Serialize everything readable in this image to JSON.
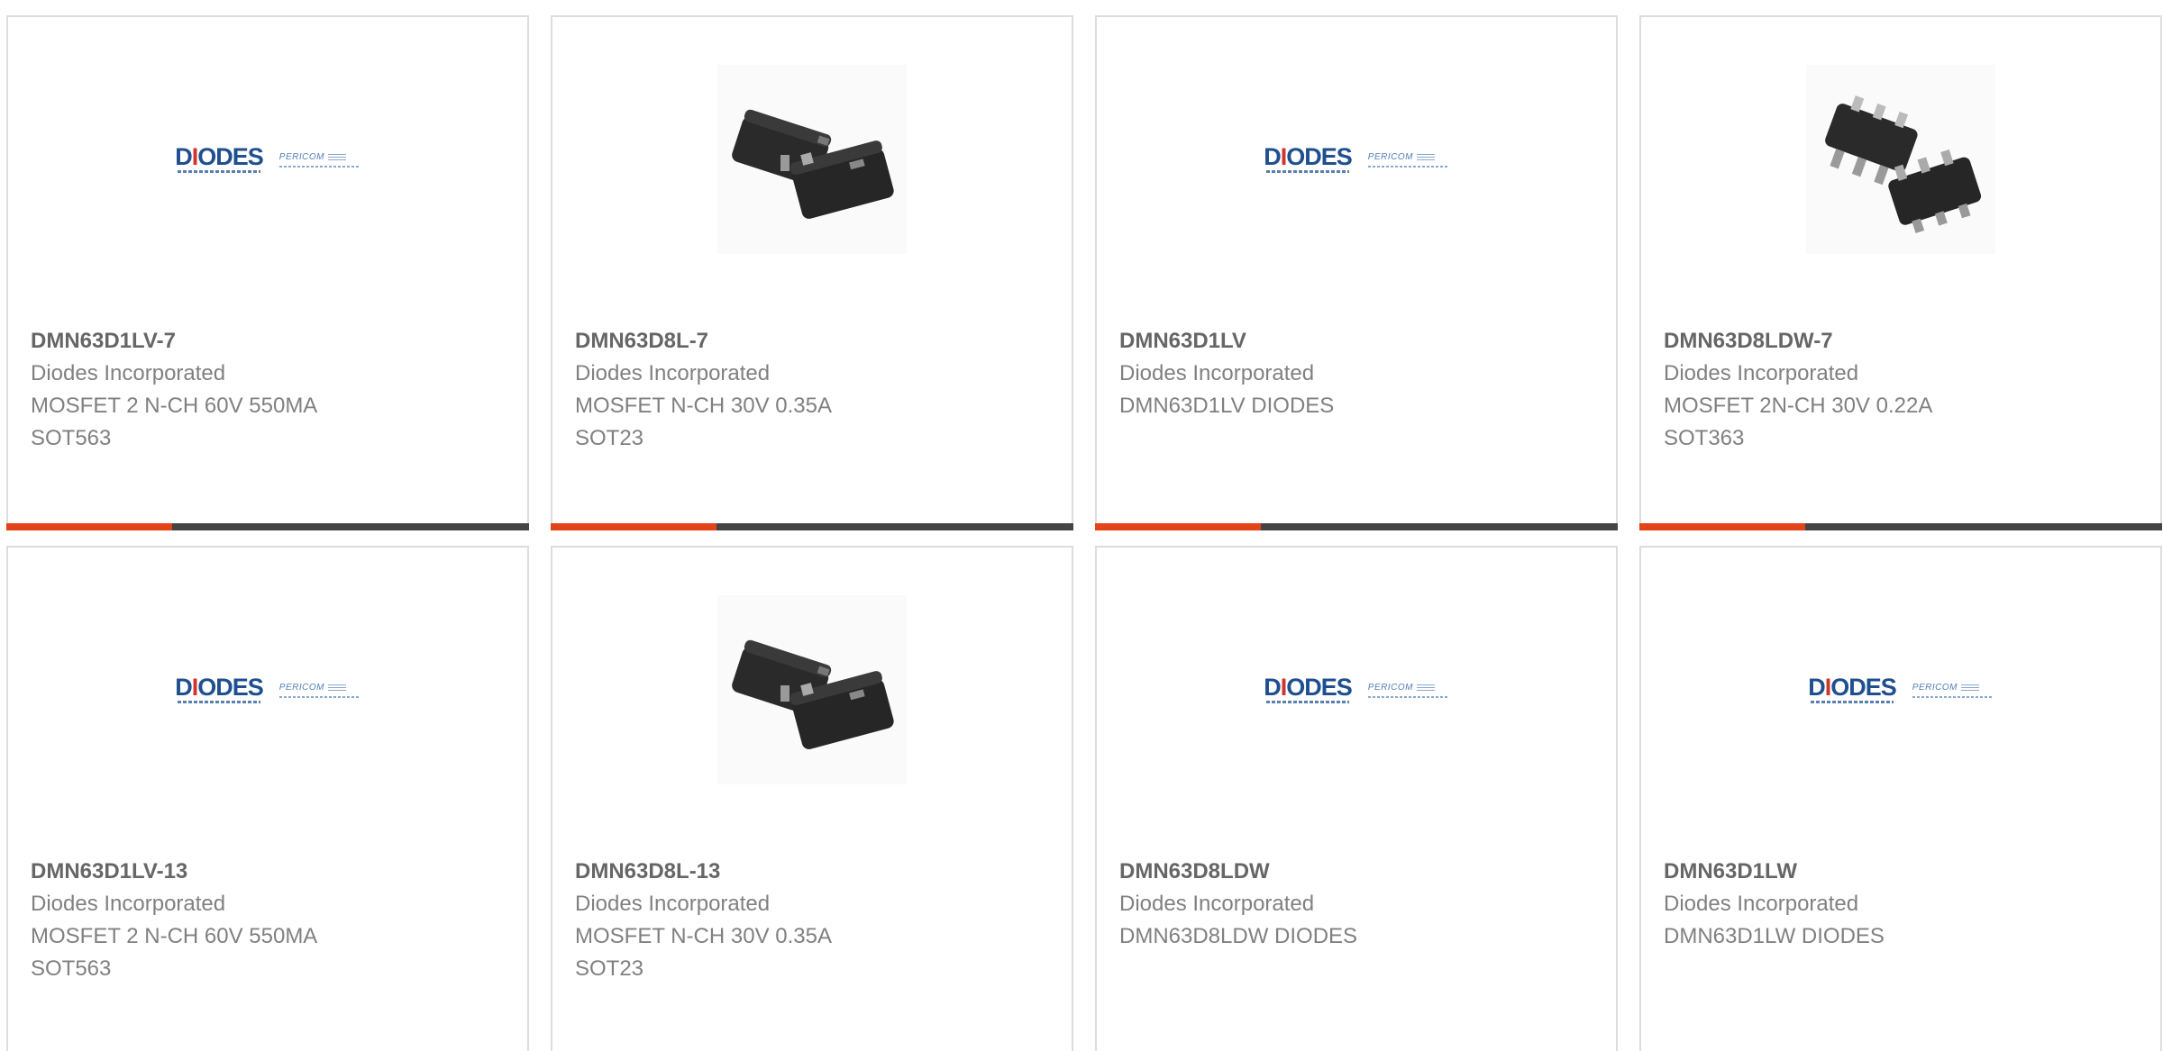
{
  "products": [
    {
      "part": "DMN63D1LV-7",
      "manufacturer": "Diodes Incorporated",
      "desc1": "MOSFET 2 N-CH 60V 550MA",
      "desc2": "SOT563",
      "image": "diodes-pericom-logo"
    },
    {
      "part": "DMN63D8L-7",
      "manufacturer": "Diodes Incorporated",
      "desc1": "MOSFET N-CH 30V 0.35A",
      "desc2": "SOT23",
      "image": "sot23-chip-photo"
    },
    {
      "part": "DMN63D1LV",
      "manufacturer": "Diodes Incorporated",
      "desc1": "DMN63D1LV DIODES",
      "desc2": "",
      "image": "diodes-pericom-logo"
    },
    {
      "part": "DMN63D8LDW-7",
      "manufacturer": "Diodes Incorporated",
      "desc1": "MOSFET 2N-CH 30V 0.22A",
      "desc2": "SOT363",
      "image": "sot363-chip-photo"
    },
    {
      "part": "DMN63D1LV-13",
      "manufacturer": "Diodes Incorporated",
      "desc1": "MOSFET 2 N-CH 60V 550MA",
      "desc2": "SOT563",
      "image": "diodes-pericom-logo"
    },
    {
      "part": "DMN63D8L-13",
      "manufacturer": "Diodes Incorporated",
      "desc1": "MOSFET N-CH 30V 0.35A",
      "desc2": "SOT23",
      "image": "sot23-chip-photo"
    },
    {
      "part": "DMN63D8LDW",
      "manufacturer": "Diodes Incorporated",
      "desc1": "DMN63D8LDW DIODES",
      "desc2": "",
      "image": "diodes-pericom-logo"
    },
    {
      "part": "DMN63D1LW",
      "manufacturer": "Diodes Incorporated",
      "desc1": "DMN63D1LW DIODES",
      "desc2": "",
      "image": "diodes-pericom-logo"
    }
  ],
  "logo": {
    "diodes_text": "DIODES",
    "pericom_text": "PERICOM"
  },
  "colors": {
    "accent": "#e4431a",
    "bar": "#444444",
    "diodes_blue": "#1e4f8e",
    "border": "#dddddd"
  }
}
